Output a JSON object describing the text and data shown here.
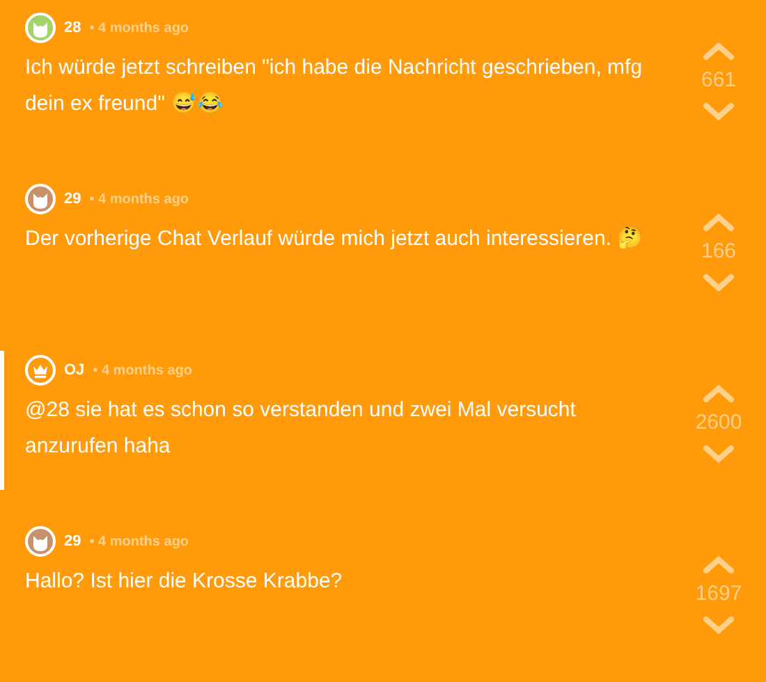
{
  "comments": [
    {
      "author": "28",
      "time": "• 4 months ago",
      "avatar": {
        "kind": "cat",
        "color": "#a5d36b"
      },
      "highlighted": false,
      "text": "Ich würde jetzt schreiben \"ich habe die Nachricht geschrieben, mfg dein ex freund\" 😅😂",
      "votes": "661"
    },
    {
      "author": "29",
      "time": "• 4 months ago",
      "avatar": {
        "kind": "cat",
        "color": "#c8906b"
      },
      "highlighted": false,
      "text": "Der vorherige Chat Verlauf würde mich jetzt auch interessieren. 🤔",
      "votes": "166"
    },
    {
      "author": "OJ",
      "time": "• 4 months ago",
      "avatar": {
        "kind": "crown"
      },
      "highlighted": true,
      "text": "@28 sie hat es schon so verstanden und zwei Mal versucht anzurufen haha",
      "votes": "2600"
    },
    {
      "author": "29",
      "time": "• 4 months ago",
      "avatar": {
        "kind": "cat",
        "color": "#c8906b"
      },
      "highlighted": false,
      "text": "Hallo? Ist hier die Krosse Krabbe?",
      "votes": "1697"
    }
  ]
}
